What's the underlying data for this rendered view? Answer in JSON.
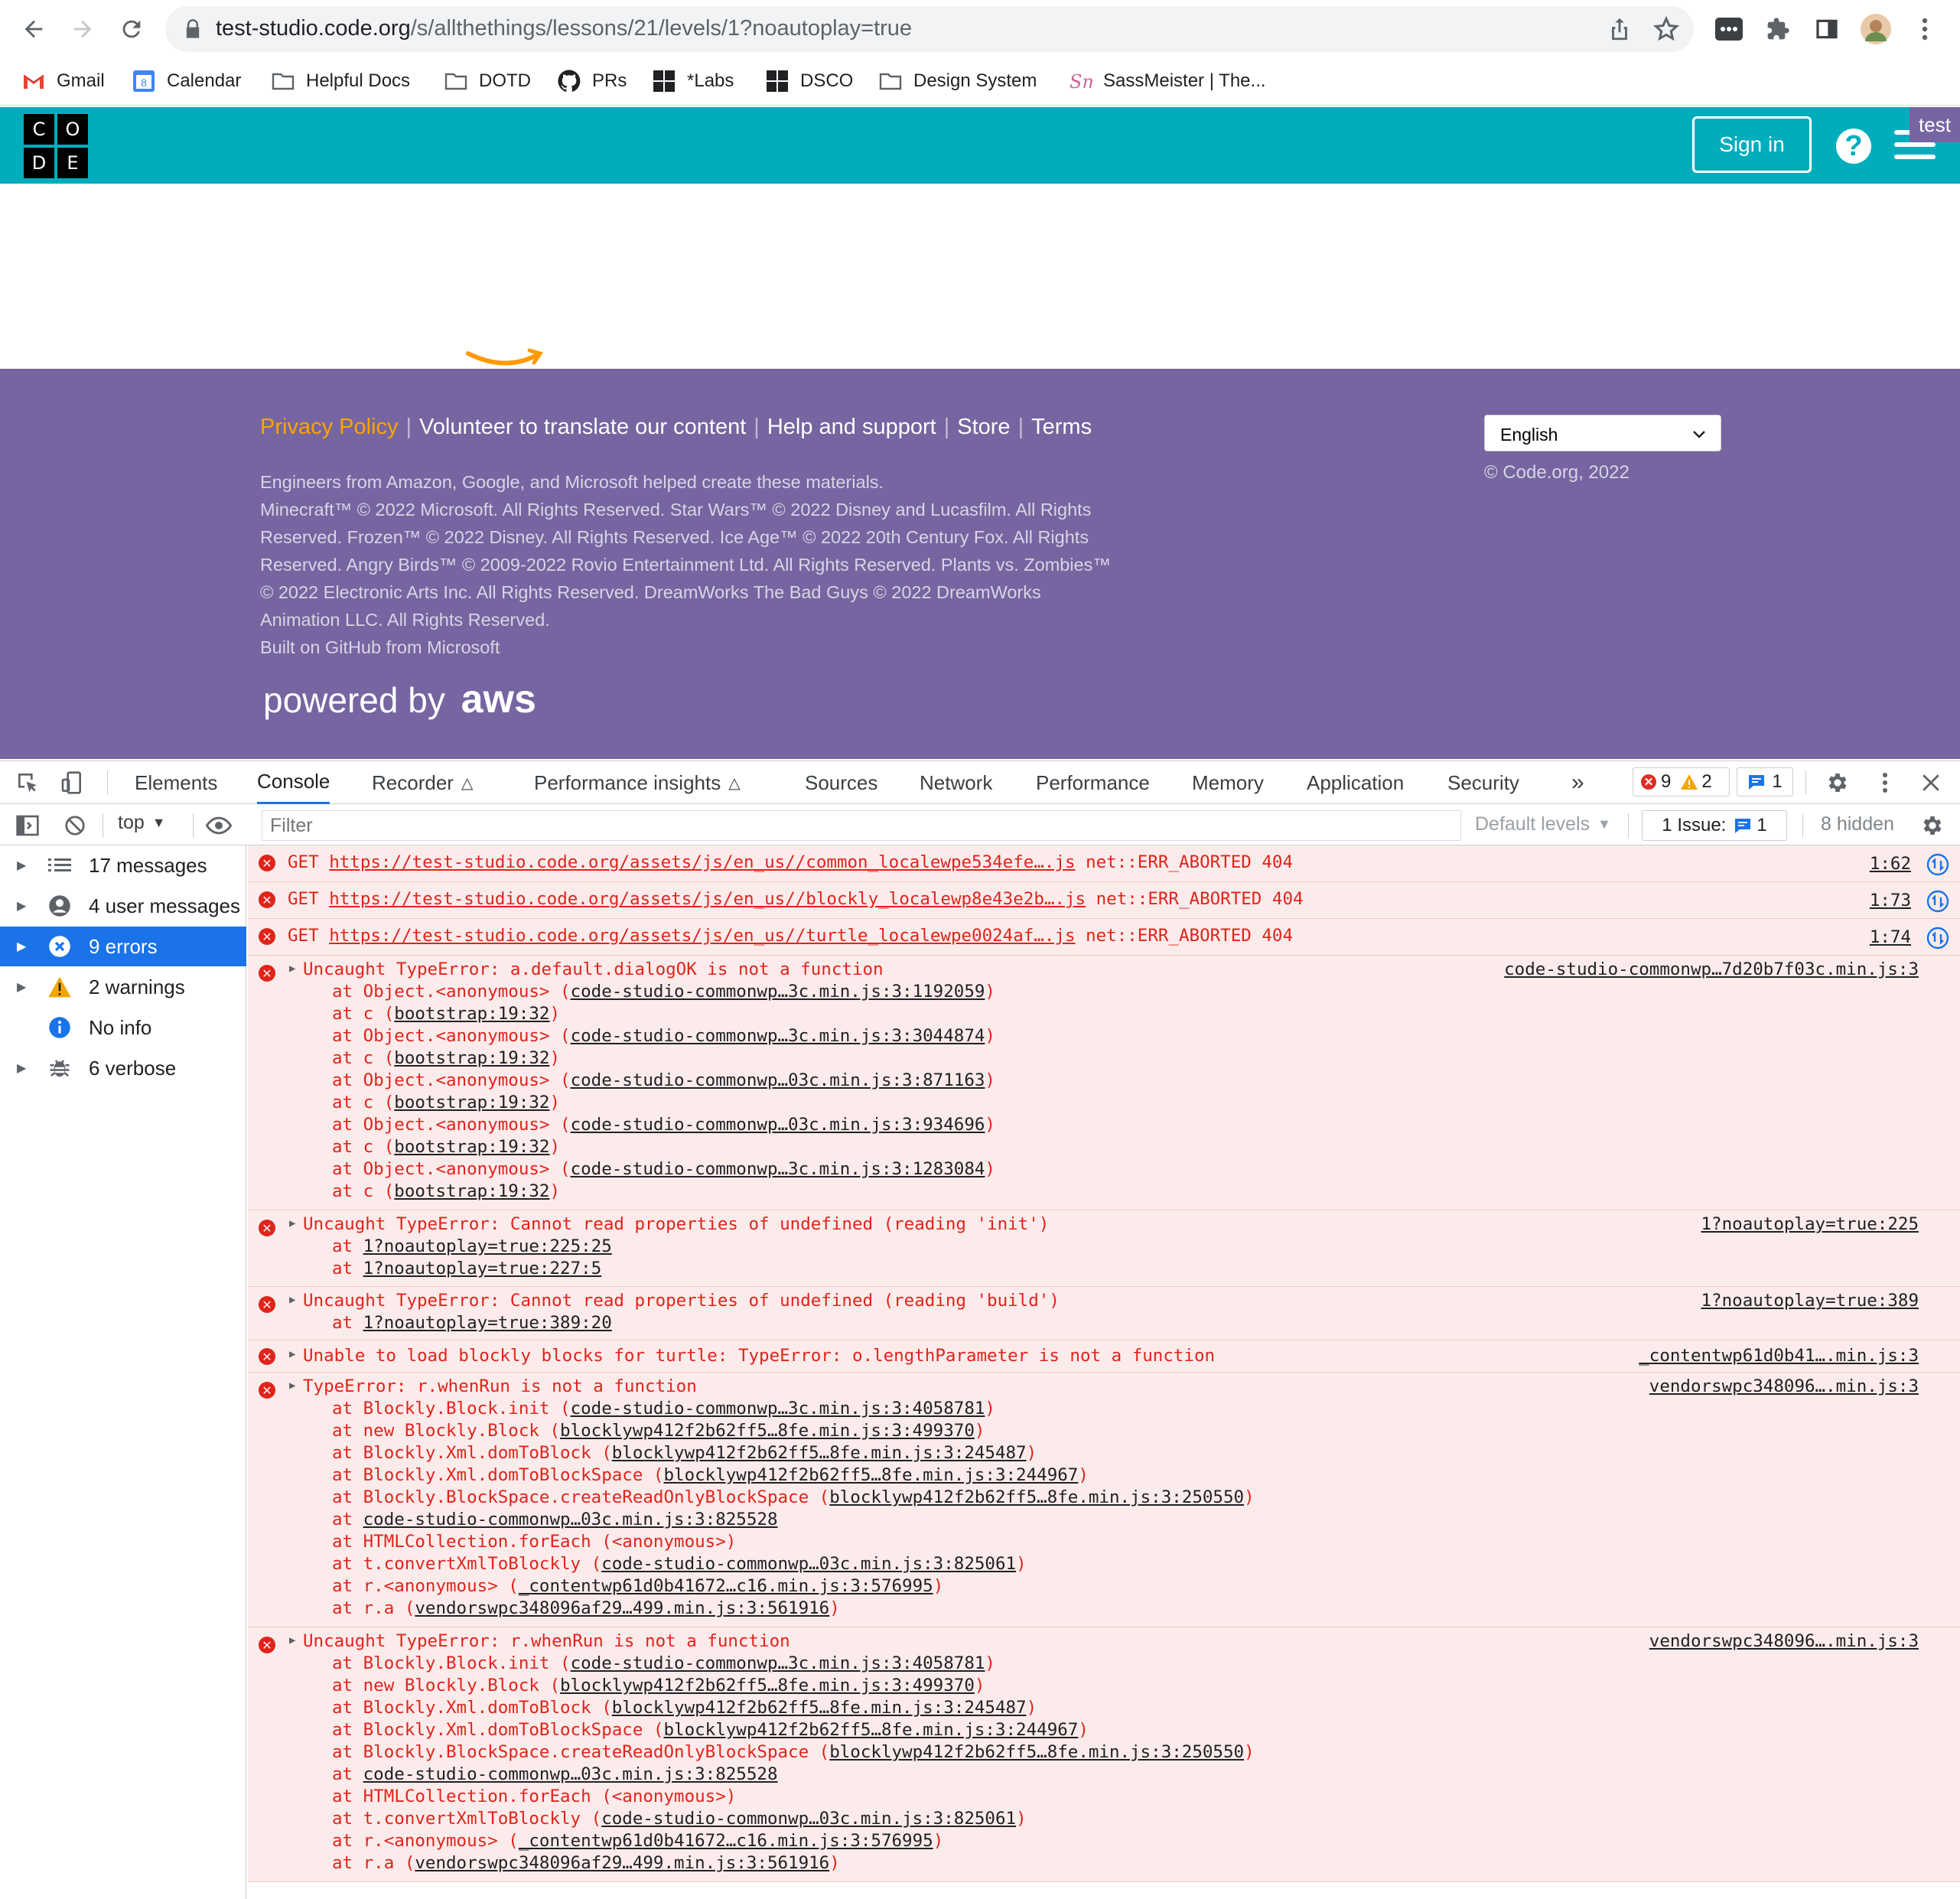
{
  "browser": {
    "url_host": "test-studio.code.org",
    "url_path": "/s/allthethings/lessons/21/levels/1?noautoplay=true",
    "bookmarks": [
      "Gmail",
      "Calendar",
      "Helpful Docs",
      "DOTD",
      "PRs",
      "*Labs",
      "DSCO",
      "Design System",
      "SassMeister | The..."
    ]
  },
  "site": {
    "logo_letters": [
      "C",
      "O",
      "D",
      "E"
    ],
    "sign_in": "Sign in",
    "help": "?",
    "env_badge": "test"
  },
  "footer": {
    "links": [
      "Privacy Policy",
      "Volunteer to translate our content",
      "Help and support",
      "Store",
      "Terms"
    ],
    "legal_lines": [
      "Engineers from Amazon, Google, and Microsoft helped create these materials.",
      "Minecraft™ © 2022 Microsoft. All Rights Reserved. Star Wars™ © 2022 Disney and Lucasfilm. All Rights",
      "Reserved. Frozen™ © 2022 Disney. All Rights Reserved. Ice Age™ © 2022 20th Century Fox. All Rights",
      "Reserved. Angry Birds™ © 2009-2022 Rovio Entertainment Ltd. All Rights Reserved. Plants vs. Zombies™",
      "© 2022 Electronic Arts Inc. All Rights Reserved. DreamWorks The Bad Guys © 2022 DreamWorks",
      "Animation LLC. All Rights Reserved.",
      "Built on GitHub from Microsoft"
    ],
    "powered_by": "powered by",
    "aws": "aws",
    "language": "English",
    "copyright": "© Code.org, 2022"
  },
  "devtools": {
    "tabs": [
      "Elements",
      "Console",
      "Recorder",
      "Performance insights",
      "Sources",
      "Network",
      "Performance",
      "Memory",
      "Application",
      "Security"
    ],
    "more_tabs": "»",
    "error_count": "9",
    "warning_count": "2",
    "message_count": "1",
    "context": "top",
    "filter_placeholder": "Filter",
    "levels": "Default levels",
    "issues_label": "1 Issue:",
    "issues_count": "1",
    "hidden": "8 hidden",
    "sidebar": [
      {
        "label": "17 messages",
        "icon": "list-icon"
      },
      {
        "label": "4 user messages",
        "icon": "user-icon"
      },
      {
        "label": "9 errors",
        "icon": "error-icon"
      },
      {
        "label": "2 warnings",
        "icon": "warning-icon"
      },
      {
        "label": "No info",
        "icon": "info-icon"
      },
      {
        "label": "6 verbose",
        "icon": "bug-icon"
      }
    ],
    "console": {
      "get_rows": [
        {
          "method": "GET",
          "url": "https://test-studio.code.org/assets/js/en_us//common_localewpe534efe….js",
          "status": "net::ERR_ABORTED 404",
          "src": "1:62"
        },
        {
          "method": "GET",
          "url": "https://test-studio.code.org/assets/js/en_us//blockly_localewp8e43e2b….js",
          "status": "net::ERR_ABORTED 404",
          "src": "1:73"
        },
        {
          "method": "GET",
          "url": "https://test-studio.code.org/assets/js/en_us//turtle_localewpe0024af….js",
          "status": "net::ERR_ABORTED 404",
          "src": "1:74"
        }
      ],
      "err1": {
        "msg": "Uncaught TypeError: a.default.dialogOK is not a function",
        "src": "code-studio-commonwp…7d20b7f03c.min.js:3",
        "stack": [
          [
            "Object.<anonymous> (",
            "code-studio-commonwp…3c.min.js:3:1192059",
            ")"
          ],
          [
            "c (",
            "bootstrap:19:32",
            ")"
          ],
          [
            "Object.<anonymous> (",
            "code-studio-commonwp…3c.min.js:3:3044874",
            ")"
          ],
          [
            "c (",
            "bootstrap:19:32",
            ")"
          ],
          [
            "Object.<anonymous> (",
            "code-studio-commonwp…03c.min.js:3:871163",
            ")"
          ],
          [
            "c (",
            "bootstrap:19:32",
            ")"
          ],
          [
            "Object.<anonymous> (",
            "code-studio-commonwp…03c.min.js:3:934696",
            ")"
          ],
          [
            "c (",
            "bootstrap:19:32",
            ")"
          ],
          [
            "Object.<anonymous> (",
            "code-studio-commonwp…3c.min.js:3:1283084",
            ")"
          ],
          [
            "c (",
            "bootstrap:19:32",
            ")"
          ]
        ]
      },
      "err2": {
        "msg": "Uncaught TypeError: Cannot read properties of undefined (reading 'init')",
        "src": "1?noautoplay=true:225",
        "stack": [
          [
            "",
            "1?noautoplay=true:225:25",
            ""
          ],
          [
            "",
            "1?noautoplay=true:227:5",
            ""
          ]
        ]
      },
      "err3": {
        "msg": "Uncaught TypeError: Cannot read properties of undefined (reading 'build')",
        "src": "1?noautoplay=true:389",
        "stack": [
          [
            "",
            "1?noautoplay=true:389:20",
            ""
          ]
        ]
      },
      "err4": {
        "msg": "Unable to load blockly blocks for turtle: TypeError: o.lengthParameter is not a function",
        "src": "_contentwp61d0b41….min.js:3"
      },
      "err5": {
        "msg": "TypeError: r.whenRun is not a function",
        "src": "vendorswpc348096….min.js:3",
        "stack": [
          [
            "Blockly.Block.init (",
            "code-studio-commonwp…3c.min.js:3:4058781",
            ")"
          ],
          [
            "new Blockly.Block (",
            "blocklywp412f2b62ff5…8fe.min.js:3:499370",
            ")"
          ],
          [
            "Blockly.Xml.domToBlock (",
            "blocklywp412f2b62ff5…8fe.min.js:3:245487",
            ")"
          ],
          [
            "Blockly.Xml.domToBlockSpace (",
            "blocklywp412f2b62ff5…8fe.min.js:3:244967",
            ")"
          ],
          [
            "Blockly.BlockSpace.createReadOnlyBlockSpace (",
            "blocklywp412f2b62ff5…8fe.min.js:3:250550",
            ")"
          ],
          [
            "",
            "code-studio-commonwp…03c.min.js:3:825528",
            ""
          ],
          [
            "HTMLCollection.forEach (<anonymous>)",
            "",
            ""
          ],
          [
            "t.convertXmlToBlockly (",
            "code-studio-commonwp…03c.min.js:3:825061",
            ")"
          ],
          [
            "r.<anonymous> (",
            "_contentwp61d0b41672…c16.min.js:3:576995",
            ")"
          ],
          [
            "r.a (",
            "vendorswpc348096af29…499.min.js:3:561916",
            ")"
          ]
        ]
      },
      "err6": {
        "msg": "Uncaught TypeError: r.whenRun is not a function",
        "src": "vendorswpc348096….min.js:3",
        "stack": [
          [
            "Blockly.Block.init (",
            "code-studio-commonwp…3c.min.js:3:4058781",
            ")"
          ],
          [
            "new Blockly.Block (",
            "blocklywp412f2b62ff5…8fe.min.js:3:499370",
            ")"
          ],
          [
            "Blockly.Xml.domToBlock (",
            "blocklywp412f2b62ff5…8fe.min.js:3:245487",
            ")"
          ],
          [
            "Blockly.Xml.domToBlockSpace (",
            "blocklywp412f2b62ff5…8fe.min.js:3:244967",
            ")"
          ],
          [
            "Blockly.BlockSpace.createReadOnlyBlockSpace (",
            "blocklywp412f2b62ff5…8fe.min.js:3:250550",
            ")"
          ],
          [
            "",
            "code-studio-commonwp…03c.min.js:3:825528",
            ""
          ],
          [
            "HTMLCollection.forEach (<anonymous>)",
            "",
            ""
          ],
          [
            "t.convertXmlToBlockly (",
            "code-studio-commonwp…03c.min.js:3:825061",
            ")"
          ],
          [
            "r.<anonymous> (",
            "_contentwp61d0b41672…c16.min.js:3:576995",
            ")"
          ],
          [
            "r.a (",
            "vendorswpc348096af29…499.min.js:3:561916",
            ")"
          ]
        ]
      },
      "at_word": "at"
    },
    "colors": {
      "error": "#e0241b",
      "error_bg": "#fcebeb",
      "selected": "#1a73e8"
    }
  }
}
